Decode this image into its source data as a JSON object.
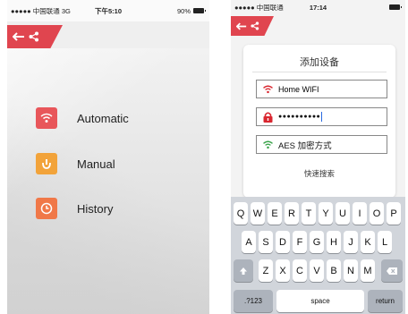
{
  "left_screen": {
    "status": {
      "carrier": "●●●●● 中国联通  3G",
      "time": "下午5:10",
      "battery": "90%"
    },
    "menu": [
      {
        "label": "Automatic",
        "icon": "wifi-icon",
        "color": "#e8565a"
      },
      {
        "label": "Manual",
        "icon": "hand-icon",
        "color": "#f2a33a"
      },
      {
        "label": "History",
        "icon": "clock-icon",
        "color": "#f07848"
      }
    ]
  },
  "right_screen": {
    "status": {
      "carrier": "●●●●● 中国联通 ",
      "time": "17:14"
    },
    "card": {
      "title": "添加设备",
      "ssid_value": "Home WIFI",
      "password_value": "●●●●●●●●●●",
      "encryption_value": "AES 加密方式",
      "quick_search": "快速搜索"
    },
    "keyboard": {
      "row1": [
        "Q",
        "W",
        "E",
        "R",
        "T",
        "Y",
        "U",
        "I",
        "O",
        "P"
      ],
      "row2": [
        "A",
        "S",
        "D",
        "F",
        "G",
        "H",
        "J",
        "K",
        "L"
      ],
      "row3": [
        "Z",
        "X",
        "C",
        "V",
        "B",
        "N",
        "M"
      ],
      "numbers_key": ".?123",
      "space_key": "space",
      "return_key": "return"
    }
  },
  "colors": {
    "accent": "#e0454f",
    "lock": "#d9262f",
    "wifi_green": "#3aa34a"
  }
}
